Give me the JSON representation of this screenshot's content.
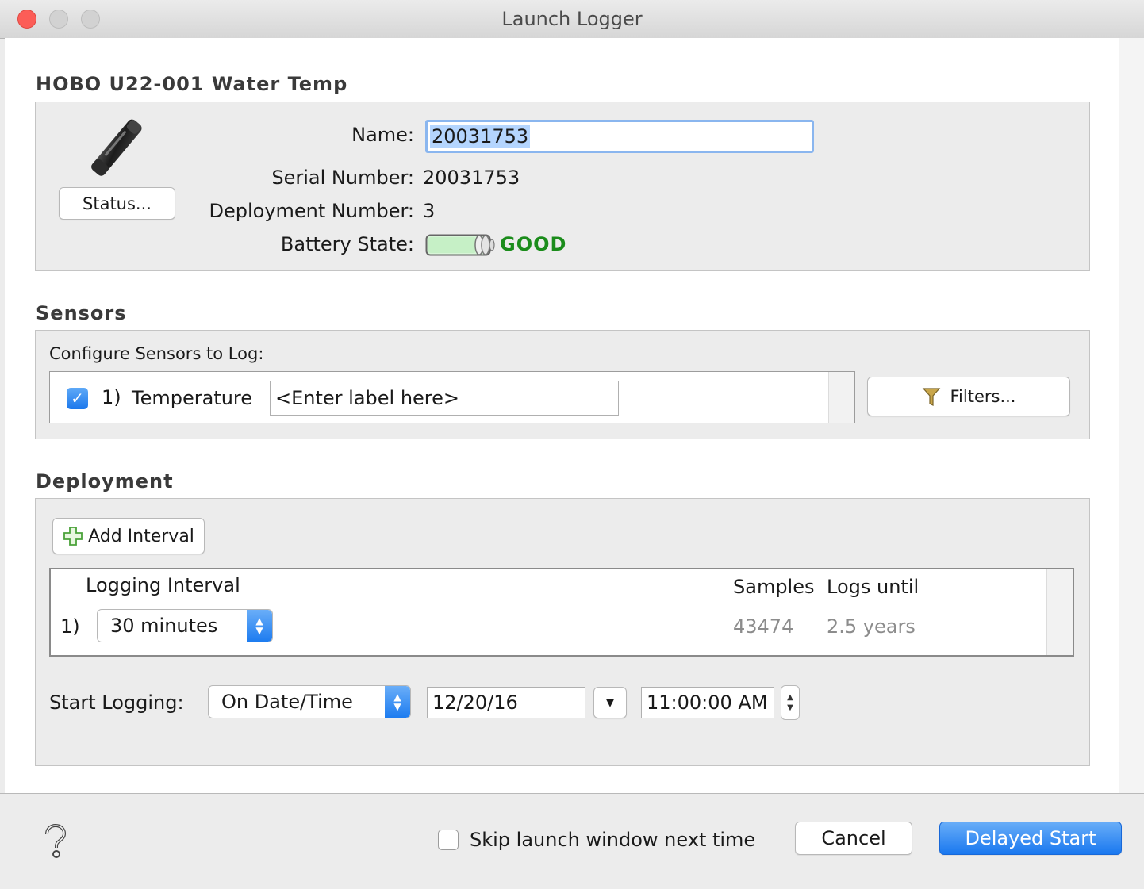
{
  "window": {
    "title": "Launch Logger"
  },
  "device": {
    "section_title": "HOBO U22-001 Water Temp",
    "status_button": "Status...",
    "name_label": "Name:",
    "name_value": "20031753",
    "serial_label": "Serial Number:",
    "serial_value": "20031753",
    "deployment_label": "Deployment Number:",
    "deployment_value": "3",
    "battery_label": "Battery State:",
    "battery_status": "GOOD",
    "battery_color": "#1b8c1b"
  },
  "sensors": {
    "section_title": "Sensors",
    "configure_label": "Configure Sensors to Log:",
    "items": [
      {
        "index": "1)",
        "name": "Temperature",
        "label_placeholder": "<Enter label here>",
        "checked": true
      }
    ],
    "filters_button": "Filters..."
  },
  "deployment": {
    "section_title": "Deployment",
    "add_interval_button": "Add Interval",
    "table": {
      "col_interval": "Logging Interval",
      "col_samples": "Samples",
      "col_logs_until": "Logs until",
      "rows": [
        {
          "index": "1)",
          "interval": "30 minutes",
          "samples": "43474",
          "logs_until": "2.5 years"
        }
      ]
    },
    "start_label": "Start Logging:",
    "start_mode": "On Date/Time",
    "start_date": "12/20/16",
    "start_time": "11:00:00 AM"
  },
  "footer": {
    "skip_label": "Skip launch window next time",
    "skip_checked": false,
    "cancel_button": "Cancel",
    "primary_button": "Delayed Start"
  },
  "colors": {
    "accent": "#1d7cf0",
    "close": "#fc5d57"
  }
}
